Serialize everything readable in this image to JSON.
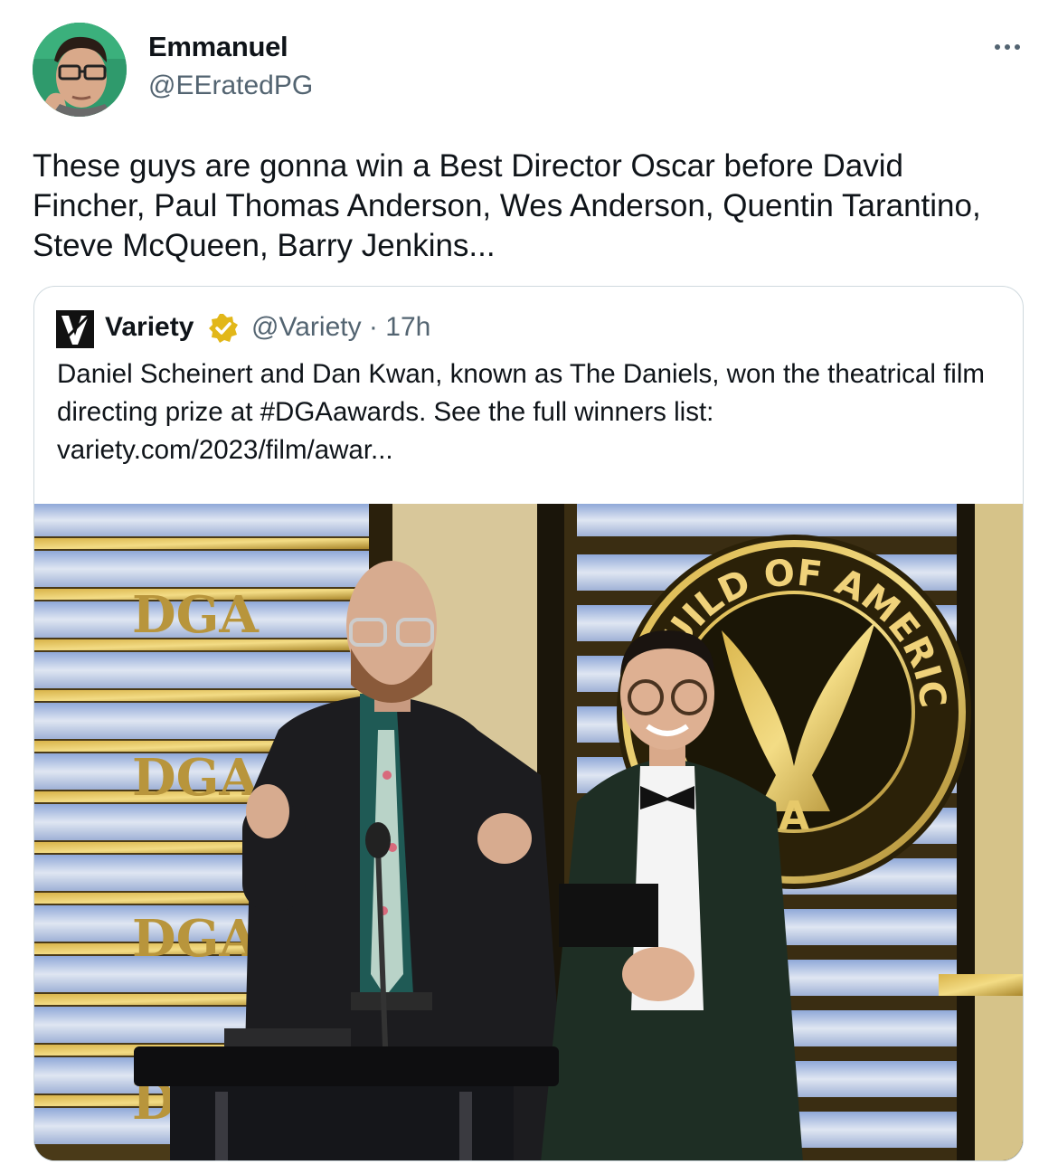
{
  "author": {
    "name": "Emmanuel",
    "handle": "@EEratedPG"
  },
  "menu": {
    "more_icon": "more-horizontal-icon"
  },
  "tweet_text": "These guys are gonna win a Best Director Oscar before David Fincher, Paul Thomas Anderson, Wes Anderson, Quentin Tarantino, Steve McQueen, Barry Jenkins...",
  "quote": {
    "name": "Variety",
    "handle_time": "@Variety · 17h",
    "text": "Daniel Scheinert and Dan Kwan, known as The Daniels, won the theatrical film directing prize at #DGAawards. See the full winners list: variety.com/2023/film/awar...",
    "photo_signage": {
      "dga_1": "DGA",
      "dga_2": "DGA",
      "dga_3": "DGA",
      "dga_4": "DGA",
      "seal_text": "GUILD OF AMERICA"
    }
  },
  "colors": {
    "text_primary": "#0f1419",
    "text_secondary": "#536471",
    "border": "#cfd9de",
    "verified_gold": "#e2b719"
  }
}
